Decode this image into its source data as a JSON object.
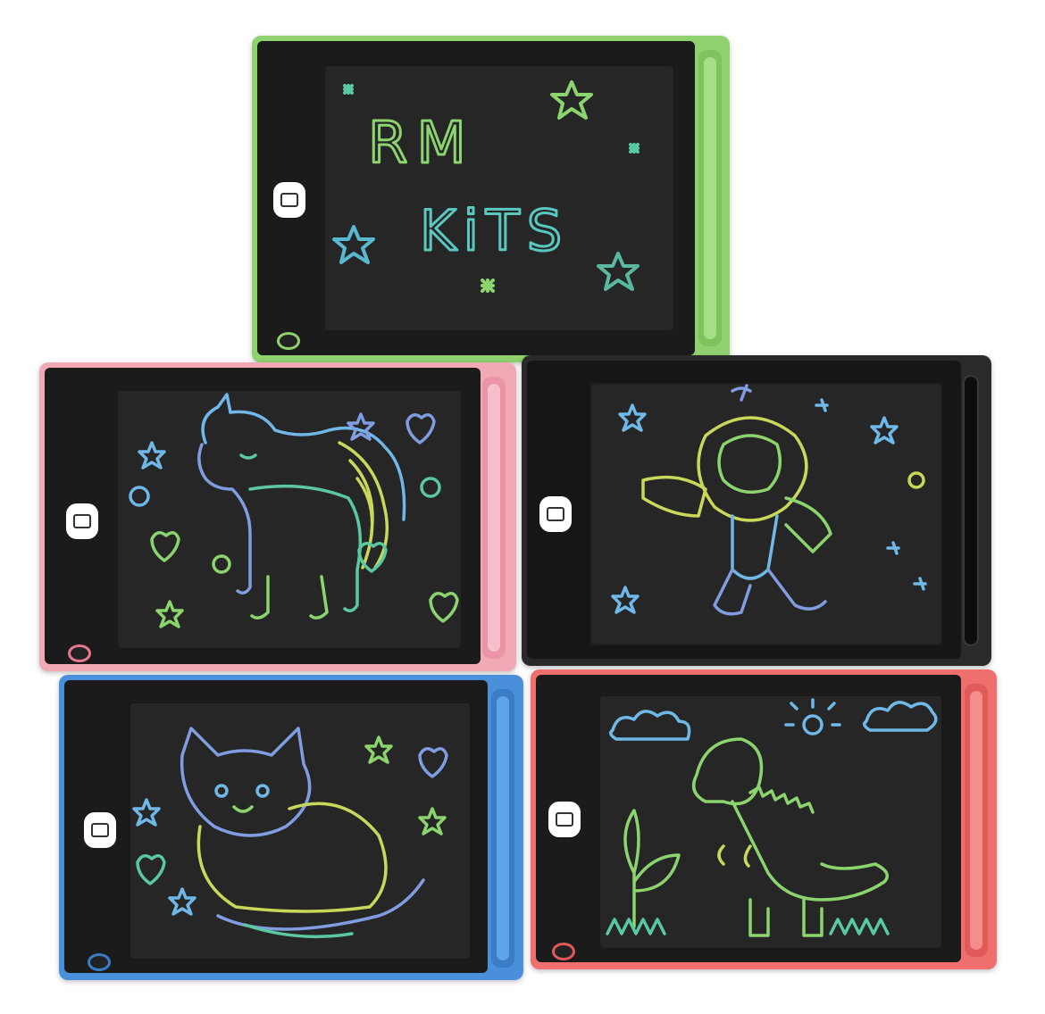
{
  "photo": {
    "tablets": [
      {
        "frame_color": "#8fd16e",
        "doodle": "text-and-stars",
        "text_lines": [
          "RM",
          "KiTS"
        ]
      },
      {
        "frame_color": "#f2a9b6",
        "doodle": "unicorn"
      },
      {
        "frame_color": "#2a2a2a",
        "doodle": "astronaut"
      },
      {
        "frame_color": "#4a8fd9",
        "doodle": "cat"
      },
      {
        "frame_color": "#ef6f6f",
        "doodle": "dinosaur"
      }
    ],
    "ink_colors": [
      "#5ac8a0",
      "#6fb8e8",
      "#8bd46e",
      "#c9d85a",
      "#7f9de0"
    ]
  }
}
